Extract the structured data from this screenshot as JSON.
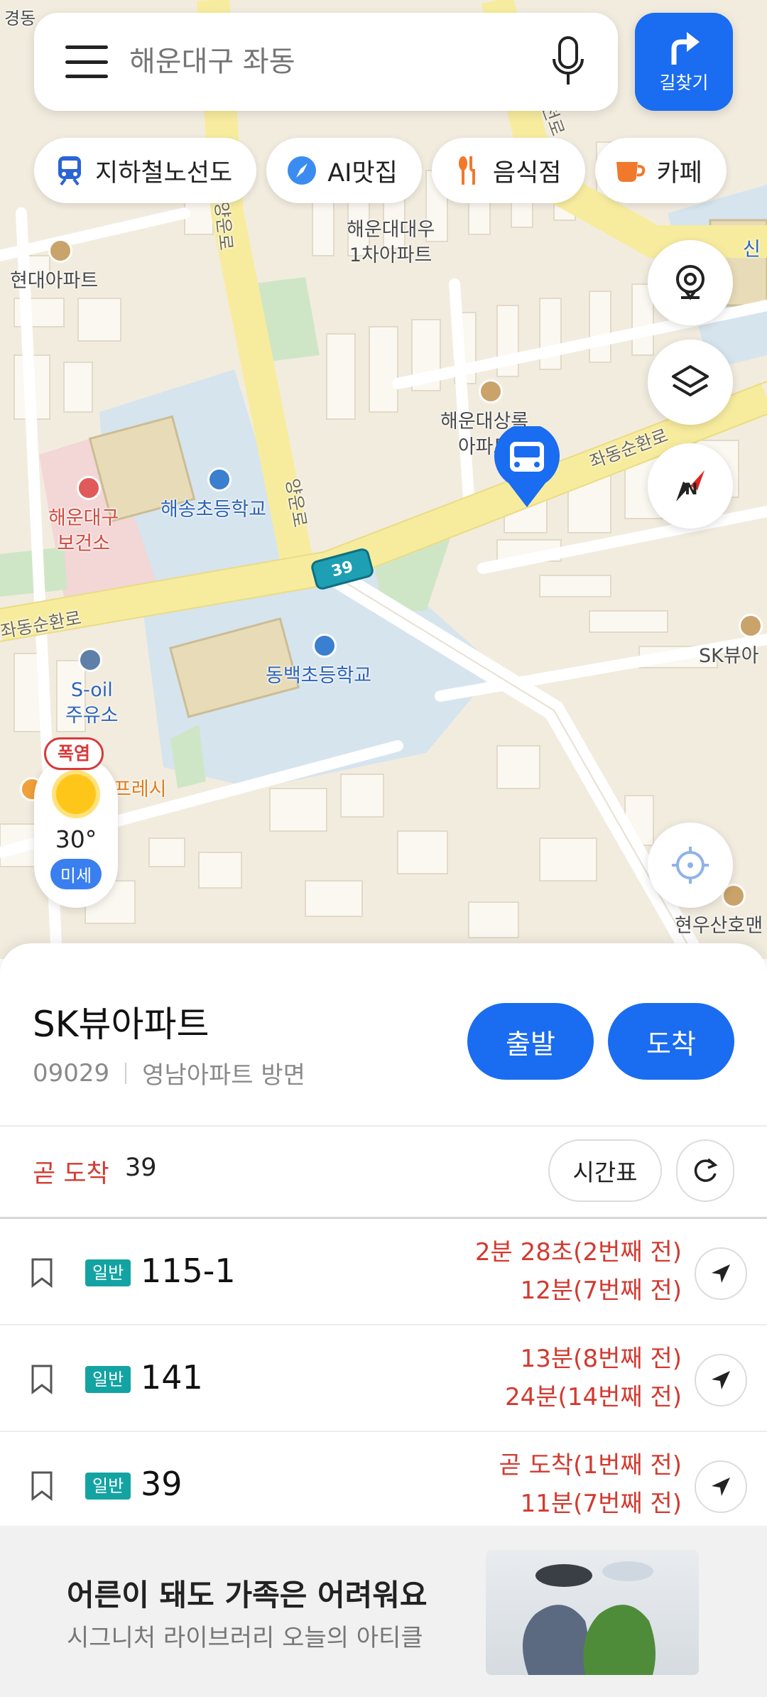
{
  "search": {
    "placeholder": "해운대구 좌동"
  },
  "route_button": {
    "label": "길찾기"
  },
  "chips": [
    {
      "label": "지하철노선도",
      "icon": "subway-icon"
    },
    {
      "label": "AI맛집",
      "icon": "compass-icon"
    },
    {
      "label": "음식점",
      "icon": "restaurant-icon"
    },
    {
      "label": "카페",
      "icon": "cafe-icon"
    }
  ],
  "map": {
    "labels": {
      "top_left_partial": "경동",
      "hyundai_apt": "현대아파트",
      "daewoo_apt": "해운대대우\n1차아파트",
      "sangnok_apt": "해운대상록\n아파트",
      "health_center": "해운대구\n보건소",
      "haesong_school": "해송초등학교",
      "dongbaek_school": "동백초등학교",
      "soil": "S-oil\n주유소",
      "sk_view": "SK뷰아",
      "hyunwoo": "현우산호맨",
      "shin": "신",
      "fresh": "프레시",
      "road_jwadong_east": "좌동순환로",
      "road_jwadong_west": "좌동순환로",
      "road_yangun": "양운로",
      "road_yangun2": "양운로",
      "road_right_top": "대천로"
    },
    "bus_marker_number": "39"
  },
  "weather": {
    "alert": "폭염",
    "temperature": "30°",
    "dust": "미세"
  },
  "stop": {
    "name": "SK뷰아파트",
    "code": "09029",
    "direction": "영남아파트 방면",
    "depart_label": "출발",
    "arrive_label": "도착"
  },
  "soon": {
    "label": "곧 도착",
    "route": "39",
    "timetable_label": "시간표"
  },
  "buses": [
    {
      "type": "일반",
      "number": "115-1",
      "arrival1": "2분 28초(2번째 전)",
      "arrival2": "12분(7번째 전)"
    },
    {
      "type": "일반",
      "number": "141",
      "arrival1": "13분(8번째 전)",
      "arrival2": "24분(14번째 전)"
    },
    {
      "type": "일반",
      "number": "39",
      "arrival1": "곧 도착(1번째 전)",
      "arrival2": "11분(7번째 전)"
    }
  ],
  "ad": {
    "title": "어른이 돼도 가족은 어려워요",
    "subtitle": "시그니처 라이브러리 오늘의 아티클"
  },
  "colors": {
    "accent": "#1a6cf0",
    "alert": "#d23a30",
    "badge": "#14a3a3"
  }
}
